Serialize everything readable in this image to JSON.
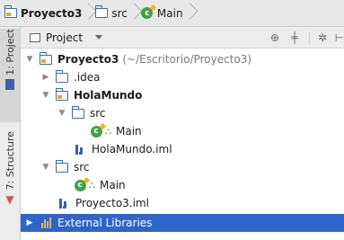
{
  "breadcrumb": {
    "items": [
      {
        "label": "Proyecto3",
        "icon": "module-folder-icon"
      },
      {
        "label": "src",
        "icon": "folder-icon"
      },
      {
        "label": "Main",
        "icon": "class-icon"
      }
    ]
  },
  "sidebar": {
    "project_tab": "1: Project",
    "structure_tab": "7: Structure"
  },
  "panel": {
    "view_selector": "Project",
    "tools": [
      "locate-icon",
      "collapse-icon",
      "settings-icon",
      "hide-icon"
    ]
  },
  "tree": {
    "root_label": "Proyecto3",
    "root_path": "(~/Escritorio/Proyecto3)",
    "idea_label": ".idea",
    "holamundo_label": "HolaMundo",
    "holamundo_src_label": "src",
    "holamundo_main_label": "Main",
    "holamundo_iml_label": "HolaMundo.iml",
    "src_label": "src",
    "src_main_label": "Main",
    "proyecto_iml_label": "Proyecto3.iml",
    "external_libraries_label": "External Libraries"
  },
  "colors": {
    "selection": "#2f65ca",
    "folder": "#3a6ea5",
    "class": "#43a047"
  }
}
